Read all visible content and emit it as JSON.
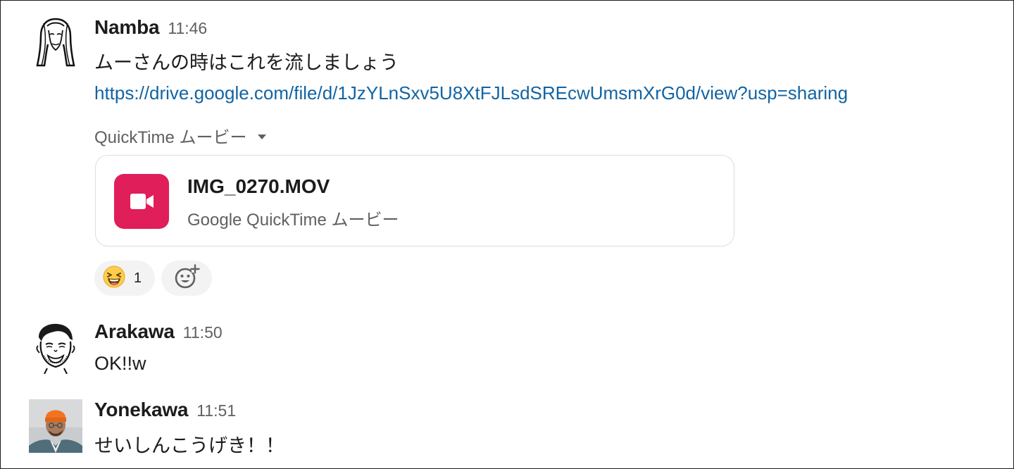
{
  "messages": [
    {
      "author": "Namba",
      "time": "11:46",
      "text": "ムーさんの時はこれを流しましょう",
      "link": "https://drive.google.com/file/d/1JzYLnSxv5U8XtFJLsdSREcwUmsmXrG0d/view?usp=sharing",
      "attachment_label": "QuickTime ムービー",
      "file": {
        "name": "IMG_0270.MOV",
        "type": "Google QuickTime ムービー",
        "icon": "video-camera-icon",
        "icon_bg": "#e01e5a"
      },
      "reactions": [
        {
          "emoji": "laughing-face-icon",
          "count": "1"
        }
      ],
      "add_reaction_icon": "add-reaction-icon"
    },
    {
      "author": "Arakawa",
      "time": "11:50",
      "text": "OK!!w"
    },
    {
      "author": "Yonekawa",
      "time": "11:51",
      "text": "せいしんこうげき！！"
    }
  ],
  "colors": {
    "link": "#1264a3",
    "muted": "#616061",
    "text": "#1d1c1d",
    "reaction_bg": "#f3f3f3",
    "card_border": "#dddddd"
  }
}
